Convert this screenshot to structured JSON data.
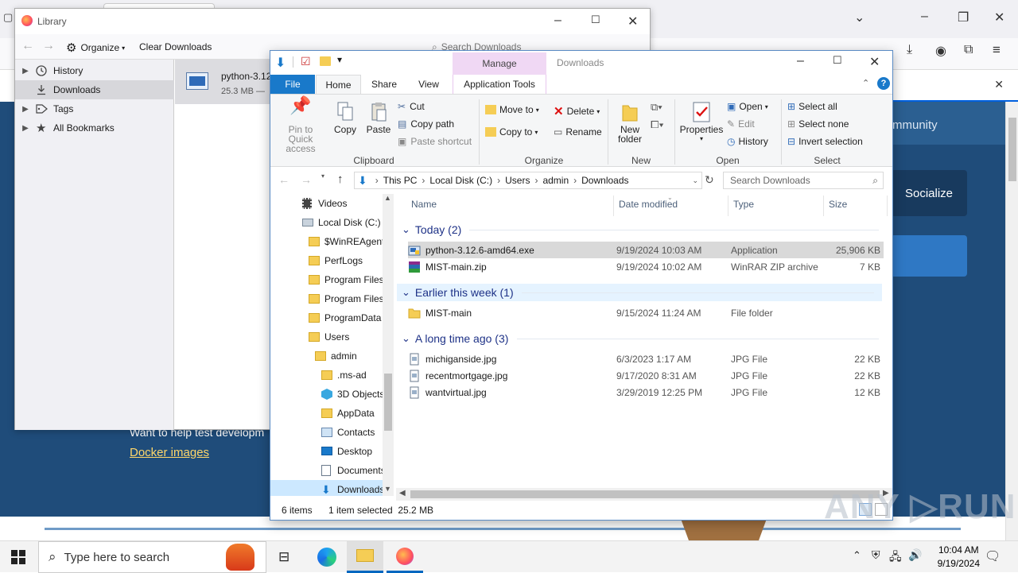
{
  "library": {
    "title": "Library",
    "organize_label": "Organize",
    "clear_downloads_label": "Clear Downloads",
    "search_placeholder": "Search Downloads",
    "sidebar": [
      {
        "label": "History",
        "icon": "clock-icon",
        "expandable": true
      },
      {
        "label": "Downloads",
        "icon": "download-icon",
        "expandable": false,
        "selected": true
      },
      {
        "label": "Tags",
        "icon": "tag-icon",
        "expandable": true
      },
      {
        "label": "All Bookmarks",
        "icon": "star-icon",
        "expandable": true
      }
    ],
    "download_item": {
      "name": "python-3.12",
      "meta": "25.3 MB —"
    }
  },
  "firefox_bg": {
    "community_text": "mmunity",
    "socialize_label": "Socialize",
    "want_text": "Want to help test developm",
    "docker_link": "Docker images"
  },
  "explorer": {
    "title": "Downloads",
    "manage_label": "Manage",
    "tabs": {
      "file": "File",
      "home": "Home",
      "share": "Share",
      "view": "View",
      "app_tools": "Application Tools"
    },
    "ribbon": {
      "clipboard": {
        "label": "Clipboard",
        "pin": "Pin to Quick access",
        "copy": "Copy",
        "paste": "Paste",
        "cut": "Cut",
        "copy_path": "Copy path",
        "paste_shortcut": "Paste shortcut"
      },
      "organize": {
        "label": "Organize",
        "move_to": "Move to",
        "copy_to": "Copy to",
        "delete": "Delete",
        "rename": "Rename"
      },
      "new": {
        "label": "New",
        "new_folder": "New folder"
      },
      "open": {
        "label": "Open",
        "properties": "Properties",
        "open": "Open",
        "edit": "Edit",
        "history": "History"
      },
      "select": {
        "label": "Select",
        "select_all": "Select all",
        "select_none": "Select none",
        "invert": "Invert selection"
      }
    },
    "address": [
      "This PC",
      "Local Disk (C:)",
      "Users",
      "admin",
      "Downloads"
    ],
    "search_placeholder": "Search Downloads",
    "nav": [
      {
        "label": "Videos",
        "icon": "videos-icon",
        "indent": 0
      },
      {
        "label": "Local Disk (C:)",
        "icon": "drive-icon",
        "indent": 0
      },
      {
        "label": "$WinREAgent",
        "icon": "folder-icon",
        "indent": 1
      },
      {
        "label": "PerfLogs",
        "icon": "folder-icon",
        "indent": 1
      },
      {
        "label": "Program Files",
        "icon": "folder-icon",
        "indent": 1
      },
      {
        "label": "Program Files",
        "icon": "folder-icon",
        "indent": 1
      },
      {
        "label": "ProgramData",
        "icon": "folder-icon",
        "indent": 1
      },
      {
        "label": "Users",
        "icon": "folder-icon",
        "indent": 1
      },
      {
        "label": "admin",
        "icon": "folder-icon",
        "indent": 2
      },
      {
        "label": ".ms-ad",
        "icon": "folder-icon",
        "indent": 3
      },
      {
        "label": "3D Objects",
        "icon": "3d-objects-icon",
        "indent": 3
      },
      {
        "label": "AppData",
        "icon": "folder-icon",
        "indent": 3
      },
      {
        "label": "Contacts",
        "icon": "contacts-icon",
        "indent": 3
      },
      {
        "label": "Desktop",
        "icon": "desktop-icon",
        "indent": 3
      },
      {
        "label": "Documents",
        "icon": "documents-icon",
        "indent": 3
      },
      {
        "label": "Downloads",
        "icon": "download-icon",
        "indent": 3,
        "selected": true
      }
    ],
    "columns": {
      "name": "Name",
      "date": "Date modified",
      "type": "Type",
      "size": "Size"
    },
    "groups": [
      {
        "label": "Today (2)",
        "files": [
          {
            "name": "python-3.12.6-amd64.exe",
            "date": "9/19/2024 10:03 AM",
            "type": "Application",
            "size": "25,906 KB",
            "icon": "installer-icon",
            "selected": true
          },
          {
            "name": "MIST-main.zip",
            "date": "9/19/2024 10:02 AM",
            "type": "WinRAR ZIP archive",
            "size": "7 KB",
            "icon": "winrar-icon"
          }
        ]
      },
      {
        "label": "Earlier this week (1)",
        "files": [
          {
            "name": "MIST-main",
            "date": "9/15/2024 11:24 AM",
            "type": "File folder",
            "size": "",
            "icon": "folder-icon"
          }
        ]
      },
      {
        "label": "A long time ago (3)",
        "files": [
          {
            "name": "michiganside.jpg",
            "date": "6/3/2023 1:17 AM",
            "type": "JPG File",
            "size": "22 KB",
            "icon": "image-file-icon"
          },
          {
            "name": "recentmortgage.jpg",
            "date": "9/17/2020 8:31 AM",
            "type": "JPG File",
            "size": "22 KB",
            "icon": "image-file-icon"
          },
          {
            "name": "wantvirtual.jpg",
            "date": "3/29/2019 12:25 PM",
            "type": "JPG File",
            "size": "12 KB",
            "icon": "image-file-icon"
          }
        ]
      }
    ],
    "status": {
      "items": "6 items",
      "selected": "1 item selected  25.2 MB"
    }
  },
  "taskbar": {
    "search_placeholder": "Type here to search",
    "time": "10:04 AM",
    "date": "9/19/2024"
  },
  "watermark": "ANY.RUN"
}
